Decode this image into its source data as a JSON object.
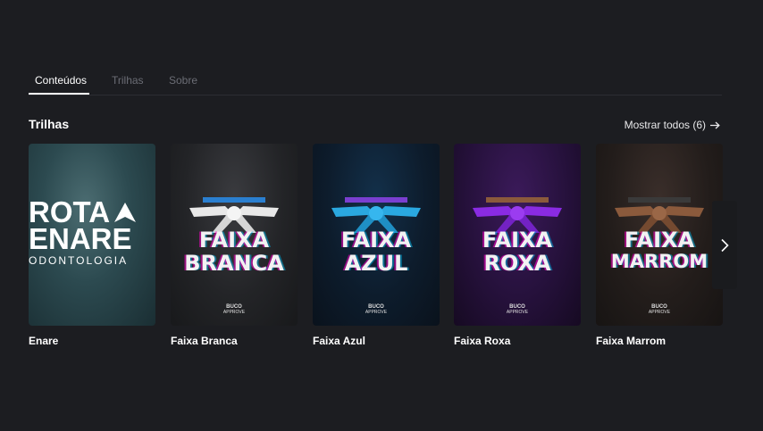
{
  "tabs": [
    {
      "label": "Conteúdos",
      "active": true
    },
    {
      "label": "Trilhas",
      "active": false
    },
    {
      "label": "Sobre",
      "active": false
    }
  ],
  "section": {
    "title": "Trilhas",
    "show_all": "Mostrar todos (6)"
  },
  "cards": [
    {
      "title": "Enare",
      "cover": {
        "line1": "ROTA",
        "line2": "ENARE",
        "line3": "ODONTOLOGIA"
      }
    },
    {
      "title": "Faixa Branca",
      "cover": {
        "word1": "FAIXA",
        "word2": "BRANCA",
        "belt_color": "#e8e8e8",
        "logo": "BUCO",
        "logo_sub": "APPROVE"
      }
    },
    {
      "title": "Faixa Azul",
      "cover": {
        "word1": "FAIXA",
        "word2": "AZUL",
        "belt_color": "#2aa8e0",
        "logo": "BUCO",
        "logo_sub": "APPROVE"
      }
    },
    {
      "title": "Faixa Roxa",
      "cover": {
        "word1": "FAIXA",
        "word2": "ROXA",
        "belt_color": "#8a2be2",
        "logo": "BUCO",
        "logo_sub": "APPROVE"
      }
    },
    {
      "title": "Faixa Marrom",
      "cover": {
        "word1": "FAIXA",
        "word2": "MARROM",
        "belt_color": "#8b5a3c",
        "logo": "BUCO",
        "logo_sub": "APPROVE"
      }
    }
  ],
  "icons": {
    "arrow": "arrow-right-icon",
    "next": "chevron-right-icon"
  },
  "colors": {
    "background": "#1c1d21",
    "tab_inactive": "#6b6d75",
    "text": "#ffffff"
  }
}
